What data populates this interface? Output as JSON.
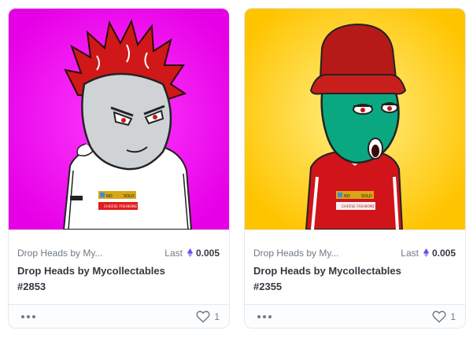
{
  "colors": {
    "accent_eth": "#7b61ff",
    "card_bg_pink": "#ff00ff",
    "card_bg_yellow": "#ffc400"
  },
  "icons": {
    "price": "ethereum-icon",
    "menu": "more-horizontal-icon",
    "favorite": "heart-icon"
  },
  "cards": [
    {
      "collection": "Drop Heads by My...",
      "last_label": "Last",
      "last_price": "0.005",
      "title": "Drop Heads by Mycollectables #2853",
      "favorites": "1",
      "image": {
        "background": "#ff00ff",
        "badge_left": "NO",
        "badge_right": "SOLD",
        "tag": "CHEESE FISHBONE"
      }
    },
    {
      "collection": "Drop Heads by My...",
      "last_label": "Last",
      "last_price": "0.005",
      "title": "Drop Heads by Mycollectables #2355",
      "favorites": "1",
      "image": {
        "background": "#ffc400",
        "badge_left": "NO",
        "badge_right": "SOLD",
        "tag": "CHEESE FISHBONE"
      }
    }
  ]
}
